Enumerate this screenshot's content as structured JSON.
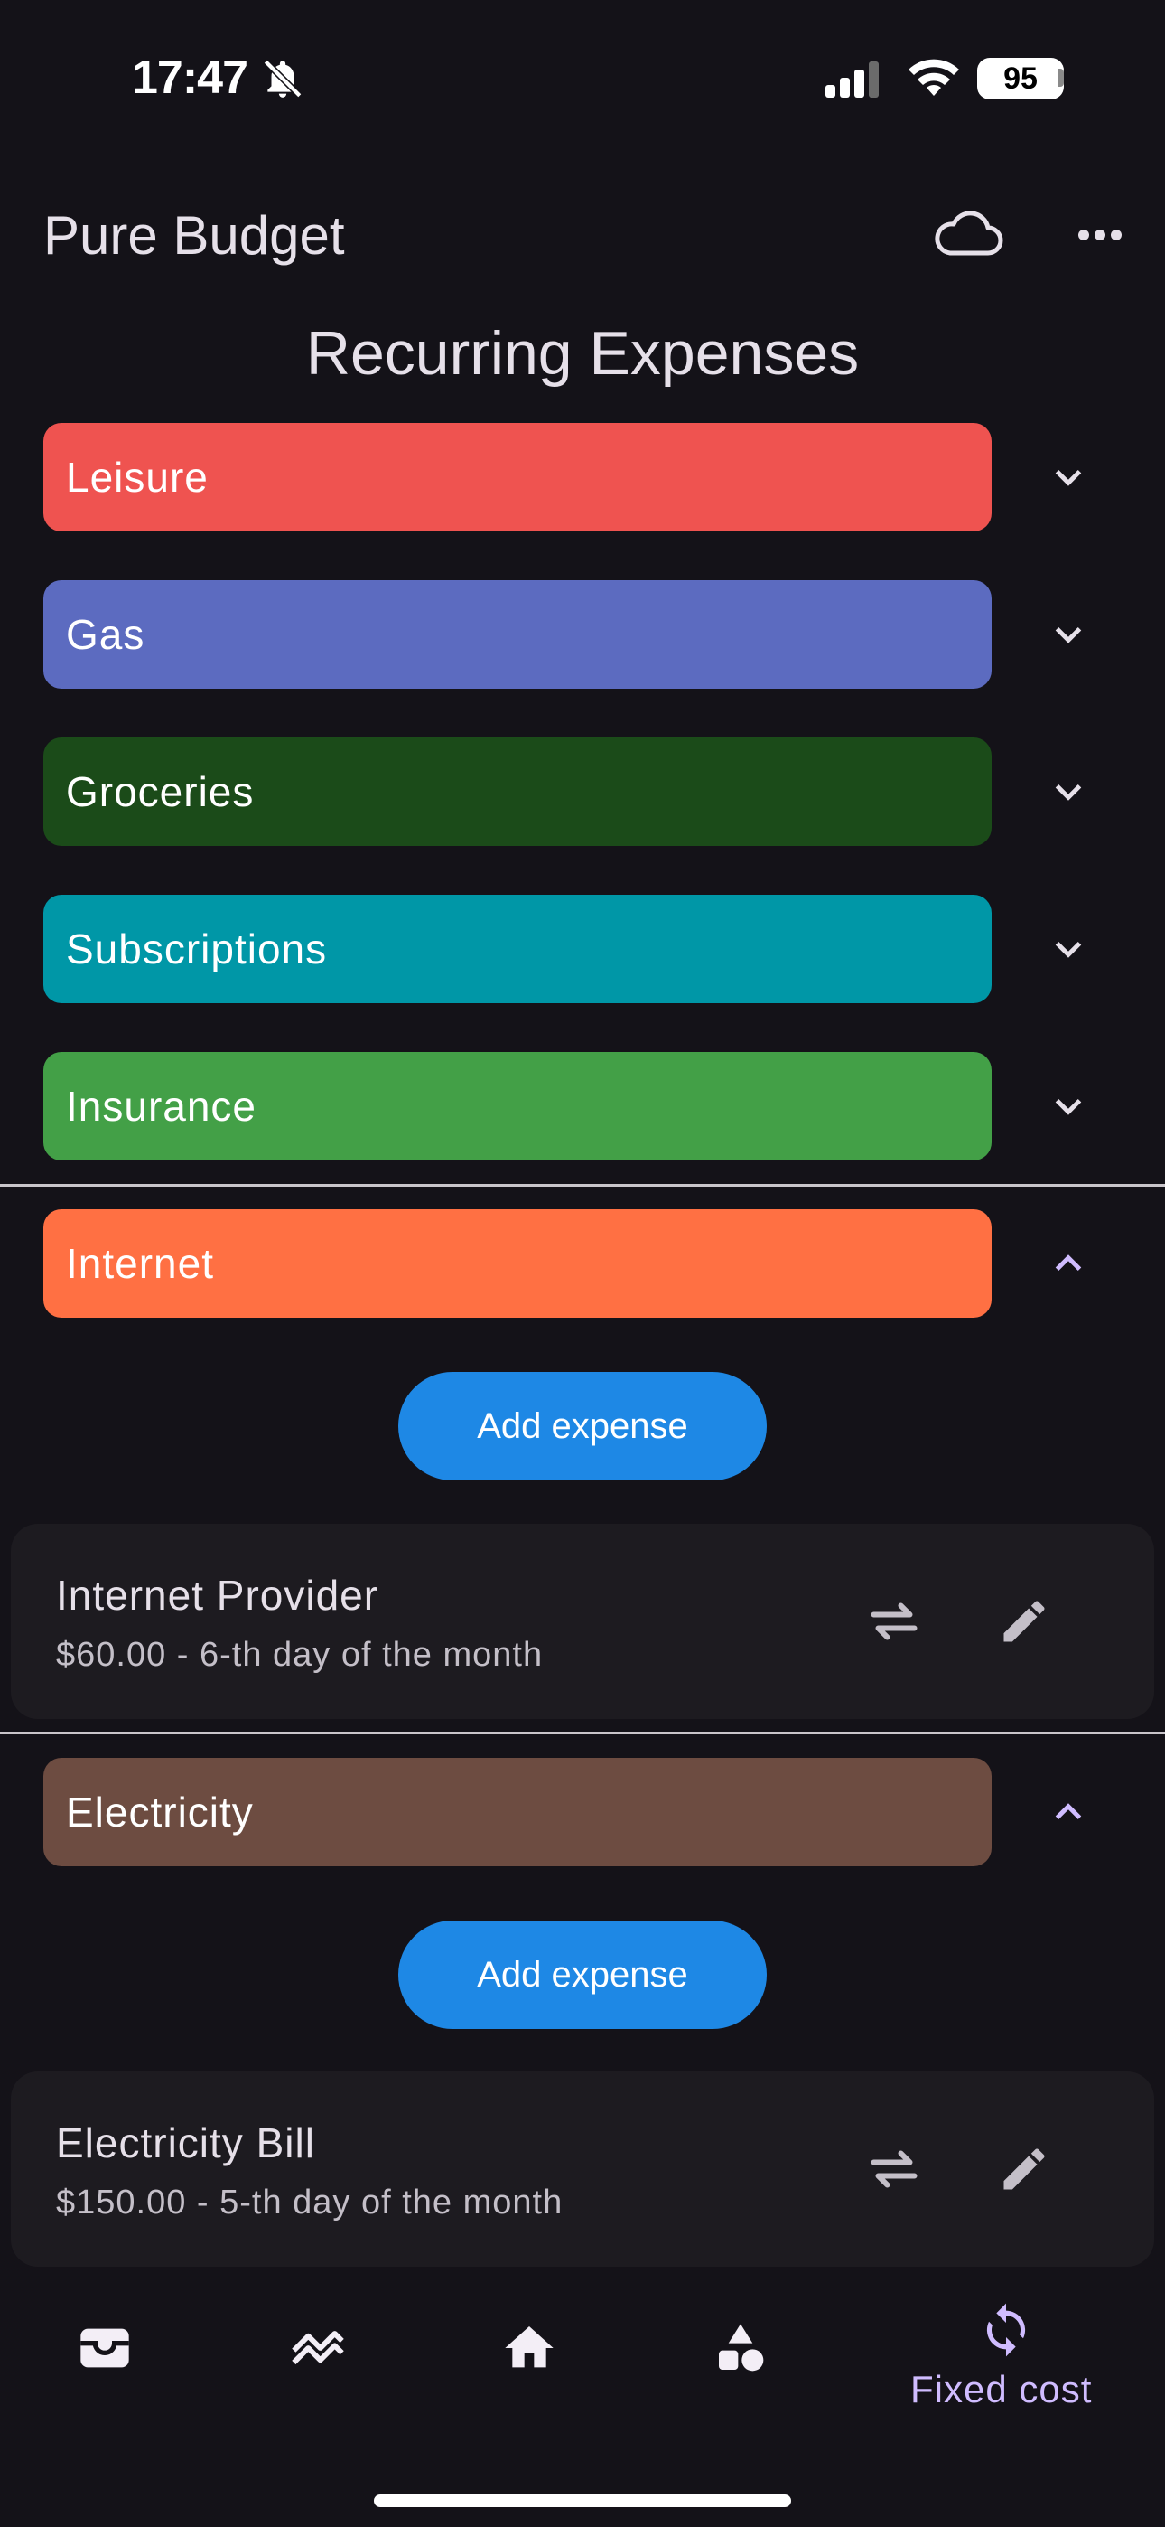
{
  "status_bar": {
    "time": "17:47",
    "battery": "95",
    "icons": [
      "bell-slash-icon",
      "cellular-signal-icon",
      "wifi-icon",
      "battery-icon"
    ]
  },
  "app_bar": {
    "title": "Pure Budget",
    "actions": [
      "cloud-icon",
      "more-horizontal-icon"
    ]
  },
  "page": {
    "title": "Recurring Expenses"
  },
  "categories": [
    {
      "label": "Leisure",
      "color": "#ef5350",
      "expanded": false
    },
    {
      "label": "Gas",
      "color": "#5c6bc0",
      "expanded": false
    },
    {
      "label": "Groceries",
      "color": "#1b4b19",
      "expanded": false
    },
    {
      "label": "Subscriptions",
      "color": "#0097a7",
      "expanded": false
    },
    {
      "label": "Insurance",
      "color": "#43a047",
      "expanded": false
    },
    {
      "label": "Internet",
      "color": "#ff7043",
      "expanded": true,
      "add_button": "Add expense",
      "expenses": [
        {
          "name": "Internet Provider",
          "detail": "$60.00 - 6-th day of the month"
        }
      ]
    },
    {
      "label": "Electricity",
      "color": "#6d4c41",
      "expanded": true,
      "add_button": "Add expense",
      "expenses": [
        {
          "name": "Electricity Bill",
          "detail": "$150.00 - 5-th day of the month"
        }
      ]
    }
  ],
  "bottom_nav": {
    "items": [
      {
        "icon": "wallet-icon"
      },
      {
        "icon": "trending-icon"
      },
      {
        "icon": "home-icon"
      },
      {
        "icon": "categories-icon"
      },
      {
        "icon": "sync-icon",
        "label": "Fixed cost",
        "active": true
      }
    ]
  },
  "colors": {
    "background": "#141218",
    "accent": "#d0bcff",
    "button": "#1e88e5",
    "card": "#1d1b20"
  }
}
